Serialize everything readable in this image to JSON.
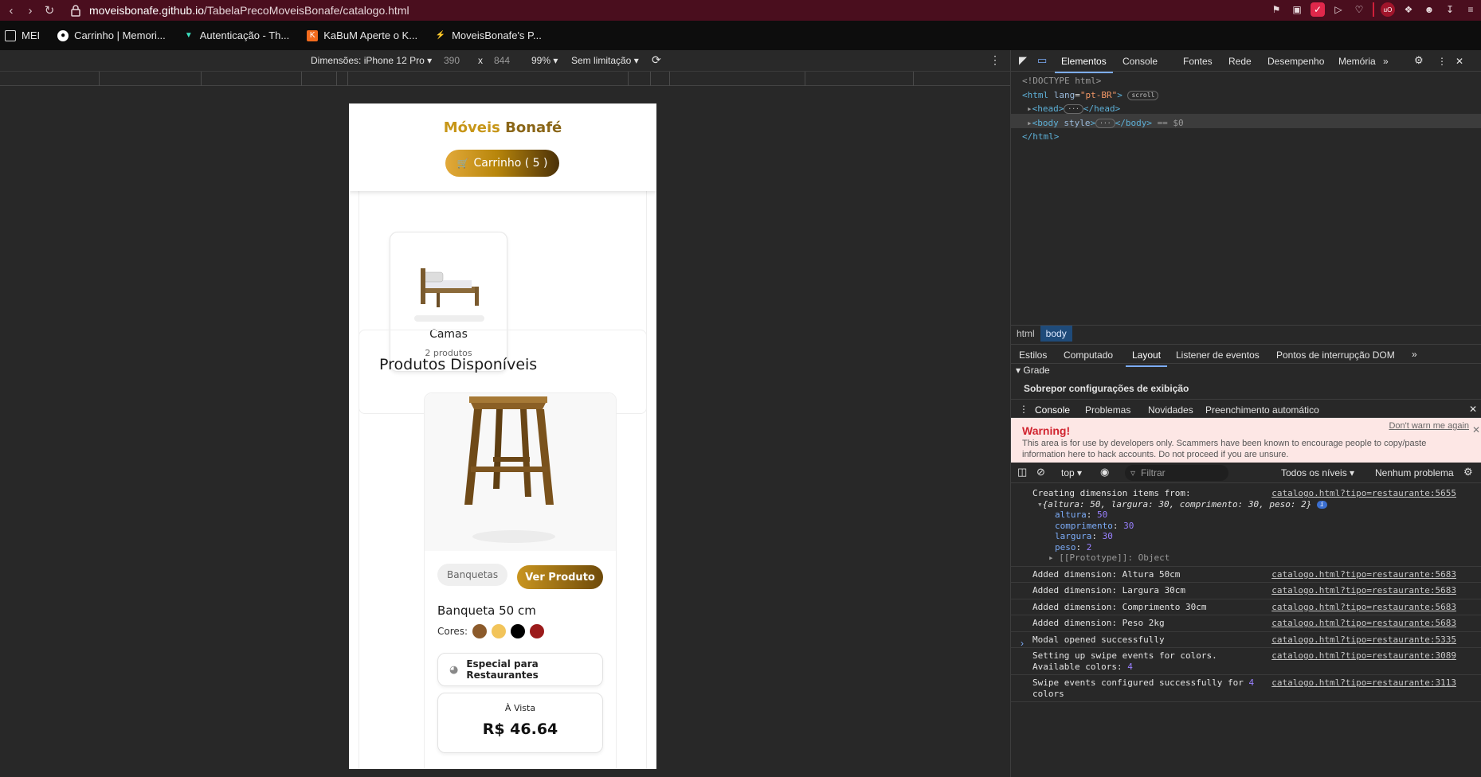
{
  "browser": {
    "url_host": "moveisbonafe.github.io",
    "url_path": "/TabelaPrecoMoveisBonafe/catalogo.html",
    "bookmarks": [
      "MEI",
      "Carrinho | Memori...",
      "Autenticação - Th...",
      "KaBuM Aperte o K...",
      "MoveisBonafe's P..."
    ]
  },
  "device_toolbar": {
    "dimensions_label": "Dimensões: iPhone 12 Pro",
    "width": "390",
    "times": "x",
    "height": "844",
    "zoom": "99%",
    "throttle": "Sem limitação"
  },
  "site": {
    "brand_part1": "Móveis",
    "brand_part2": "Bonafé",
    "cart_label": "Carrinho ( 5 )",
    "category": {
      "name": "Camas",
      "count": "2 produtos"
    },
    "section_title": "Produtos Disponíveis",
    "product": {
      "tag": "Banquetas",
      "view_button": "Ver Produto",
      "name": "Banqueta 50 cm",
      "colors_label": "Cores:",
      "colors": [
        "#8b5a2b",
        "#f2c45a",
        "#000000",
        "#9b1b1b"
      ],
      "badge": "Especial para Restaurantes",
      "price_label": "À Vista",
      "price": "R$ 46.64"
    }
  },
  "devtools": {
    "tabs": [
      "Elementos",
      "Console",
      "Fontes",
      "Rede",
      "Desempenho",
      "Memória"
    ],
    "dom": {
      "doctype": "<!DOCTYPE html>",
      "html_open": "<html",
      "lang_attr": "lang",
      "lang_val": "\"pt-BR\"",
      "scroll_pill": "scroll",
      "head": "<head>",
      "head_close": "</head>",
      "body": "<body",
      "style_attr": "style",
      "body_close": "</body>",
      "eq": "== $0",
      "html_close": "</html>"
    },
    "breadcrumbs": [
      "html",
      "body"
    ],
    "sub_tabs": [
      "Estilos",
      "Computado",
      "Layout",
      "Listener de eventos",
      "Pontos de interrupção DOM"
    ],
    "grid_label": "Grade",
    "overlay_label": "Sobrepor configurações de exibição",
    "console_tabs": [
      "Console",
      "Problemas",
      "Novidades",
      "Preenchimento automático"
    ],
    "warning_title": "Warning!",
    "warning_text": "This area is for use by developers only. Scammers have been known to encourage people to copy/paste information here to hack accounts. Do not proceed if you are unsure.",
    "warning_link": "Don't warn me again",
    "context": "top",
    "filter_placeholder": "Filtrar",
    "levels": "Todos os níveis",
    "issues": "Nenhum problema",
    "log": {
      "creating": "Creating dimension items from:",
      "creating_src": "catalogo.html?tipo=restaurante:5655",
      "object_summary": "{altura: 50, largura: 30, comprimento: 30, peso: 2}",
      "props": [
        {
          "k": "altura",
          "v": "50"
        },
        {
          "k": "comprimento",
          "v": "30"
        },
        {
          "k": "largura",
          "v": "30"
        },
        {
          "k": "peso",
          "v": "2"
        }
      ],
      "prototype": "[[Prototype]]: Object",
      "entries": [
        {
          "text": "Added dimension: Altura 50cm",
          "src": "catalogo.html?tipo=restaurante:5683"
        },
        {
          "text": "Added dimension: Largura 30cm",
          "src": "catalogo.html?tipo=restaurante:5683"
        },
        {
          "text": "Added dimension: Comprimento 30cm",
          "src": "catalogo.html?tipo=restaurante:5683"
        },
        {
          "text": "Added dimension: Peso 2kg",
          "src": "catalogo.html?tipo=restaurante:5683"
        },
        {
          "text": "Modal opened successfully",
          "src": "catalogo.html?tipo=restaurante:5335"
        }
      ],
      "swipe_setup_1": "Setting up swipe events for colors.",
      "swipe_setup_2": "Available colors: ",
      "swipe_setup_num": "4",
      "swipe_setup_src": "catalogo.html?tipo=restaurante:3089",
      "swipe_done_1": "Swipe events configured successfully for ",
      "swipe_done_num": "4",
      "swipe_done_2": "colors",
      "swipe_done_src": "catalogo.html?tipo=restaurante:3113"
    }
  }
}
